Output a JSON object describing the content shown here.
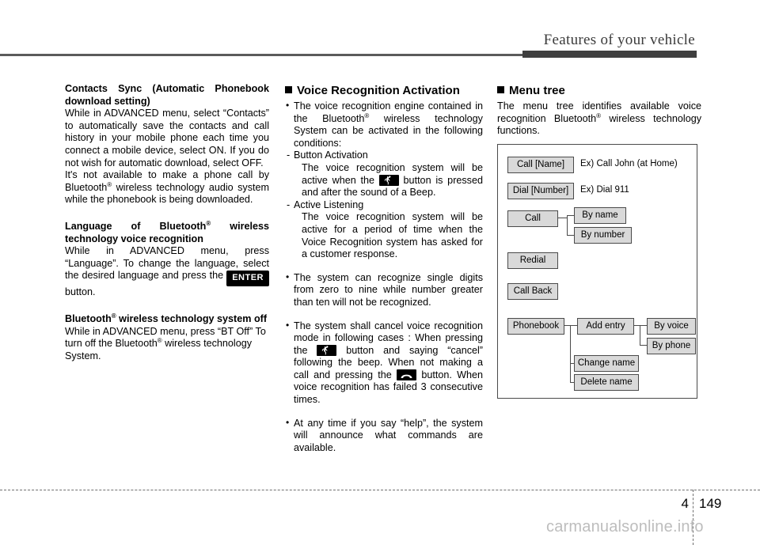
{
  "header": {
    "title": "Features of your vehicle"
  },
  "footer": {
    "chapter": "4",
    "page": "149",
    "watermark": "carmanualsonline.info"
  },
  "left_column": {
    "heading1": "Contacts Sync (Automatic Phonebook download setting)",
    "para1": "While in ADVANCED menu, select “Contacts” to automatically save the contacts and call history in your mobile phone each time you connect a mobile device, select ON. If you do not wish for automatic download, select OFF.",
    "para2_pre": "It's not  available to make a phone call by Bluetooth",
    "para2_post": " wireless technology audio system while the  phonebook is being downloaded.",
    "heading2_pre": "Language of Bluetooth",
    "heading2_post": " wireless technology voice recognition",
    "para3_pre": "While in ADVANCED menu, press “Language”. To change the language, select the desired language and press the ",
    "enter_key": "ENTER",
    "para3_post": " button.",
    "heading3_pre": "Bluetooth",
    "heading3_post": " wireless technology system off",
    "para4_pre": "While in ADVANCED menu, press “BT Off” To turn off the Bluetooth",
    "para4_post": " wireless technology System."
  },
  "mid_column": {
    "heading": "Voice Recognition Activation",
    "bullet1_pre": "The voice recognition engine contained in the Bluetooth",
    "bullet1_post": " wireless technology System can be activated in the following conditions:",
    "sub1_label": "Button Activation",
    "sub1_text_pre": "The voice recognition system will be active when the ",
    "sub1_text_post": " button is pressed and after the sound of a Beep.",
    "sub2_label": "Active Listening",
    "sub2_text": "The voice recognition system will be active for a period of time when the Voice Recognition system has asked for a customer response.",
    "bullet2": "The system can recognize single digits from zero to nine while number greater than ten will not be recognized.",
    "bullet3_a": "The system shall cancel voice recognition mode in following cases : When pressing the ",
    "bullet3_b": " button and saying “cancel” following the beep. When not making a call and pressing the ",
    "bullet3_c": " button. When voice recognition has failed 3 consecutive times.",
    "bullet4": "At any time if you say “help”, the system will announce what commands are available."
  },
  "right_column": {
    "heading": "Menu tree",
    "intro_pre": "The menu tree identifies available voice recognition Bluetooth",
    "intro_post": " wireless technology functions."
  },
  "menu_tree": {
    "nodes": [
      {
        "label": "Call [Name]"
      },
      {
        "label": "Dial [Number]"
      },
      {
        "label": "Call"
      },
      {
        "label": "By name"
      },
      {
        "label": "By number"
      },
      {
        "label": "Redial"
      },
      {
        "label": "Call Back"
      },
      {
        "label": "Phonebook"
      },
      {
        "label": "Add entry"
      },
      {
        "label": "By voice"
      },
      {
        "label": "By phone"
      },
      {
        "label": "Change name"
      },
      {
        "label": "Delete name"
      }
    ],
    "notes": [
      {
        "text": "Ex) Call John (at Home)"
      },
      {
        "text": "Ex) Dial 911"
      }
    ]
  },
  "colors": {
    "node_fill": "#d9d9d9",
    "node_border": "#4a4a4a",
    "rule": "#3f3f3f",
    "watermark": "#bdbdbd"
  }
}
